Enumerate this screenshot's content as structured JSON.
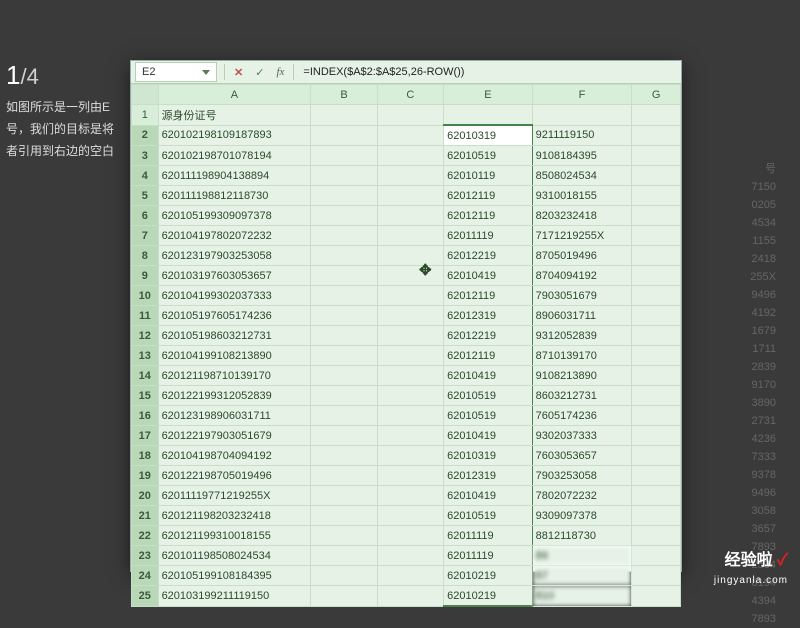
{
  "page": {
    "current": "1",
    "total": "/4"
  },
  "desc": {
    "l1": "如图所示是一列由E",
    "l2": "号，我们的目标是将",
    "l3": "者引用到右边的空白"
  },
  "faint": [
    "号",
    "7150",
    "0205",
    "4534",
    "1155",
    "2418",
    "255X",
    "9496",
    "4192",
    "1679",
    "1711",
    "2839",
    "9170",
    "3890",
    "2731",
    "4236",
    "7333",
    "9378",
    "9496",
    "3058",
    "3657",
    "7893",
    "2534",
    "8194",
    "4394",
    "7893"
  ],
  "logo": {
    "main": "经验啦",
    "check": "✓",
    "sub": "jingyanla.com"
  },
  "fbar": {
    "cell": "E2",
    "formula": "=INDEX($A$2:$A$25,26-ROW())"
  },
  "cols": [
    "",
    "A",
    "B",
    "C",
    "E",
    "F",
    "G"
  ],
  "rows": [
    {
      "n": "1",
      "a": "源身份证号",
      "e": "",
      "f": ""
    },
    {
      "n": "2",
      "a": "620102198109187893",
      "e": "62010319",
      "f": "9211119150"
    },
    {
      "n": "3",
      "a": "620102198701078194",
      "e": "62010519",
      "f": "9108184395"
    },
    {
      "n": "4",
      "a": "620111198904138894",
      "e": "62010119",
      "f": "8508024534"
    },
    {
      "n": "5",
      "a": "620111198812118730",
      "e": "62012119",
      "f": "9310018155"
    },
    {
      "n": "6",
      "a": "620105199309097378",
      "e": "62012119",
      "f": "8203232418"
    },
    {
      "n": "7",
      "a": "620104197802072232",
      "e": "62011119",
      "f": "7171219255X"
    },
    {
      "n": "8",
      "a": "620123197903253058",
      "e": "62012219",
      "f": "8705019496"
    },
    {
      "n": "9",
      "a": "620103197603053657",
      "e": "62010419",
      "f": "8704094192"
    },
    {
      "n": "10",
      "a": "620104199302037333",
      "e": "62012119",
      "f": "7903051679"
    },
    {
      "n": "11",
      "a": "620105197605174236",
      "e": "62012319",
      "f": "8906031711"
    },
    {
      "n": "12",
      "a": "620105198603212731",
      "e": "62012219",
      "f": "9312052839"
    },
    {
      "n": "13",
      "a": "620104199108213890",
      "e": "62012119",
      "f": "8710139170"
    },
    {
      "n": "14",
      "a": "620121198710139170",
      "e": "62010419",
      "f": "9108213890"
    },
    {
      "n": "15",
      "a": "620122199312052839",
      "e": "62010519",
      "f": "8603212731"
    },
    {
      "n": "16",
      "a": "620123198906031711",
      "e": "62010519",
      "f": "7605174236"
    },
    {
      "n": "17",
      "a": "620122197903051679",
      "e": "62010419",
      "f": "9302037333"
    },
    {
      "n": "18",
      "a": "620104198704094192",
      "e": "62010319",
      "f": "7603053657"
    },
    {
      "n": "19",
      "a": "620122198705019496",
      "e": "62012319",
      "f": "7903253058"
    },
    {
      "n": "20",
      "a": "62011119771219255X",
      "e": "62010419",
      "f": "7802072232"
    },
    {
      "n": "21",
      "a": "620121198203232418",
      "e": "62010519",
      "f": "9309097378"
    },
    {
      "n": "22",
      "a": "620121199310018155",
      "e": "62011119",
      "f": "8812118730"
    },
    {
      "n": "23",
      "a": "620101198508024534",
      "e": "62011119",
      "f": "89",
      "fb": true
    },
    {
      "n": "24",
      "a": "620105199108184395",
      "e": "62010219",
      "f": "87",
      "fb": true
    },
    {
      "n": "25",
      "a": "620103199211119150",
      "e": "62010219",
      "f": "810",
      "fb": true
    }
  ]
}
